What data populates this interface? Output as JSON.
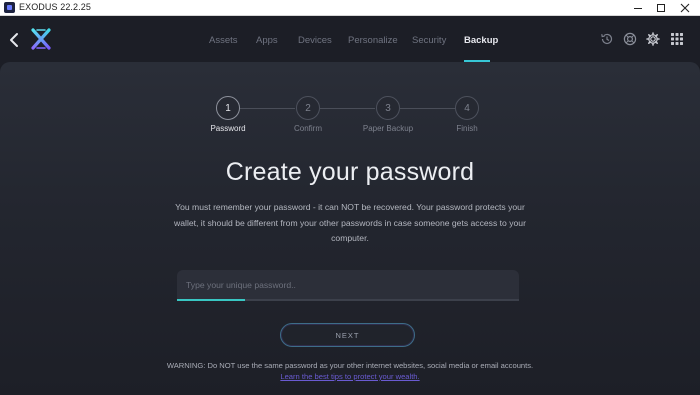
{
  "window": {
    "title": "EXODUS 22.2.25",
    "controls": [
      "minimize",
      "maximize",
      "close"
    ]
  },
  "header": {
    "nav_tabs": [
      {
        "label": "Assets"
      },
      {
        "label": "Apps"
      },
      {
        "label": "Devices"
      },
      {
        "label": "Personalize"
      },
      {
        "label": "Security"
      },
      {
        "label": "Backup",
        "active": true
      }
    ],
    "icons": [
      "back-chevron-icon",
      "exodus-logo",
      "history-icon",
      "support-icon",
      "settings-gear-icon",
      "apps-grid-icon"
    ],
    "accent_color": "#37c7d6"
  },
  "stepper": {
    "steps": [
      {
        "number": "1",
        "label": "Password",
        "active": true
      },
      {
        "number": "2",
        "label": "Confirm"
      },
      {
        "number": "3",
        "label": "Paper Backup"
      },
      {
        "number": "4",
        "label": "Finish"
      }
    ]
  },
  "main": {
    "title": "Create your password",
    "description": "You must remember your password - it can NOT be recovered. Your password protects your wallet, it should be different from your other passwords in case someone gets access to your computer.",
    "password_field": {
      "value": "",
      "placeholder": "Type your unique password..",
      "strength": 0.2
    },
    "next_button_label": "NEXT",
    "warning": "WARNING: Do NOT use the same password as your other internet websites, social media or email accounts.",
    "tips_link": "Learn the best tips to protect your wealth."
  }
}
